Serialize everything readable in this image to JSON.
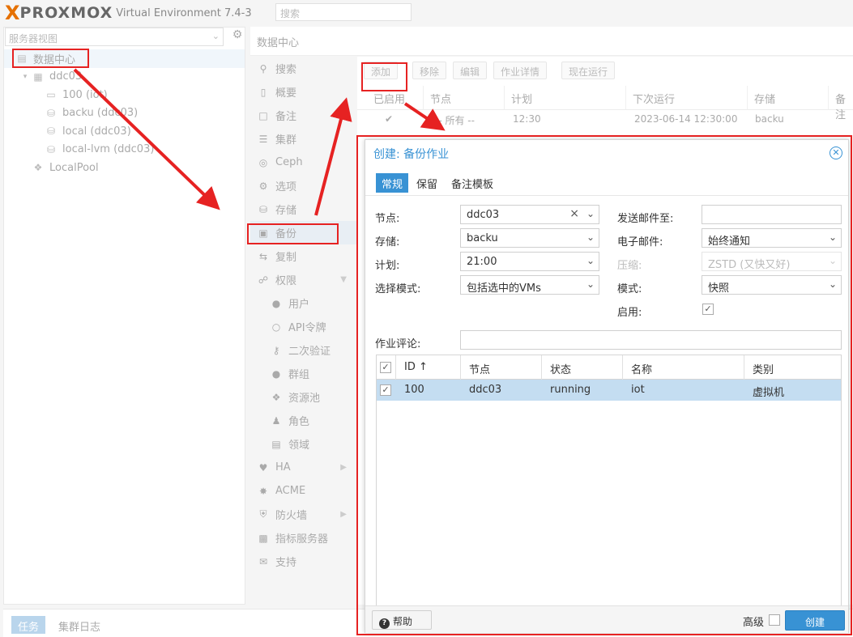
{
  "header": {
    "logo_mark": "X",
    "logo_word": "PROXMOX",
    "version": "Virtual Environment 7.4-3",
    "search_placeholder": "搜索"
  },
  "left": {
    "view_select": "服务器视图",
    "tree": [
      {
        "label": "数据中心",
        "icon": "datacenter-icon",
        "level": 0
      },
      {
        "label": "ddc03",
        "icon": "node-icon",
        "level": 1
      },
      {
        "label": "100 (iot)",
        "icon": "vm-icon",
        "level": 2
      },
      {
        "label": "backu (ddc03)",
        "icon": "storage-icon",
        "level": 2
      },
      {
        "label": "local (ddc03)",
        "icon": "storage-icon",
        "level": 2
      },
      {
        "label": "local-lvm (ddc03)",
        "icon": "storage-icon",
        "level": 2
      },
      {
        "label": "LocalPool",
        "icon": "tags-icon",
        "level": 0
      }
    ]
  },
  "middle": {
    "title": "数据中心",
    "nav": [
      {
        "label": "搜索",
        "icon": "search-icon"
      },
      {
        "label": "概要",
        "icon": "book-icon"
      },
      {
        "label": "备注",
        "icon": "note-icon"
      },
      {
        "label": "集群",
        "icon": "server-icon"
      },
      {
        "label": "Ceph",
        "icon": "ceph-icon"
      },
      {
        "label": "选项",
        "icon": "gear-icon"
      },
      {
        "label": "存储",
        "icon": "database-icon"
      },
      {
        "label": "备份",
        "icon": "floppy-icon"
      },
      {
        "label": "复制",
        "icon": "retweet-icon"
      },
      {
        "label": "权限",
        "icon": "unlock-icon"
      },
      {
        "label": "用户",
        "icon": "user-icon"
      },
      {
        "label": "API令牌",
        "icon": "user-outline-icon"
      },
      {
        "label": "二次验证",
        "icon": "key-icon"
      },
      {
        "label": "群组",
        "icon": "users-icon"
      },
      {
        "label": "资源池",
        "icon": "tags-icon"
      },
      {
        "label": "角色",
        "icon": "male-icon"
      },
      {
        "label": "领域",
        "icon": "address-book-icon"
      },
      {
        "label": "HA",
        "icon": "heartbeat-icon"
      },
      {
        "label": "ACME",
        "icon": "certificate-icon"
      },
      {
        "label": "防火墙",
        "icon": "shield-icon"
      },
      {
        "label": "指标服务器",
        "icon": "bar-chart-icon"
      },
      {
        "label": "支持",
        "icon": "comments-icon"
      }
    ]
  },
  "grid": {
    "toolbar": [
      "添加",
      "移除",
      "编辑",
      "作业详情",
      "现在运行"
    ],
    "columns": [
      "已启用",
      "节点",
      "计划",
      "下次运行",
      "存储",
      "备注"
    ],
    "row": {
      "node": "-- 所有 --",
      "schedule": "12:30",
      "next_run": "2023-06-14 12:30:00",
      "storage": "backu"
    }
  },
  "dialog": {
    "title": "创建: 备份作业",
    "tabs": [
      "常规",
      "保留",
      "备注模板"
    ],
    "fields": {
      "node_label": "节点:",
      "node_value": "ddc03",
      "storage_label": "存储:",
      "storage_value": "backu",
      "schedule_label": "计划:",
      "schedule_value": "21:00",
      "mode_select_label": "选择模式:",
      "mode_select_value": "包括选中的VMs",
      "mailto_label": "发送邮件至:",
      "mailto_value": "",
      "email_label": "电子邮件:",
      "email_value": "始终通知",
      "compress_label": "压缩:",
      "compress_value": "ZSTD (又快又好)",
      "mode_label": "模式:",
      "mode_value": "快照",
      "enabled_label": "启用:",
      "comment_label": "作业评论:",
      "comment_value": ""
    },
    "table": {
      "columns": [
        "ID ↑",
        "节点",
        "状态",
        "名称",
        "类别"
      ],
      "rows": [
        {
          "id": "100",
          "node": "ddc03",
          "status": "running",
          "name": "iot",
          "type": "虚拟机"
        }
      ]
    },
    "footer": {
      "help": "帮助",
      "advanced": "高级",
      "create": "创建"
    }
  },
  "bottom": {
    "tabs": [
      "任务",
      "集群日志"
    ]
  },
  "colors": {
    "accent": "#3892d4",
    "annotation_red": "#e62222",
    "logo_orange": "#e57000"
  }
}
